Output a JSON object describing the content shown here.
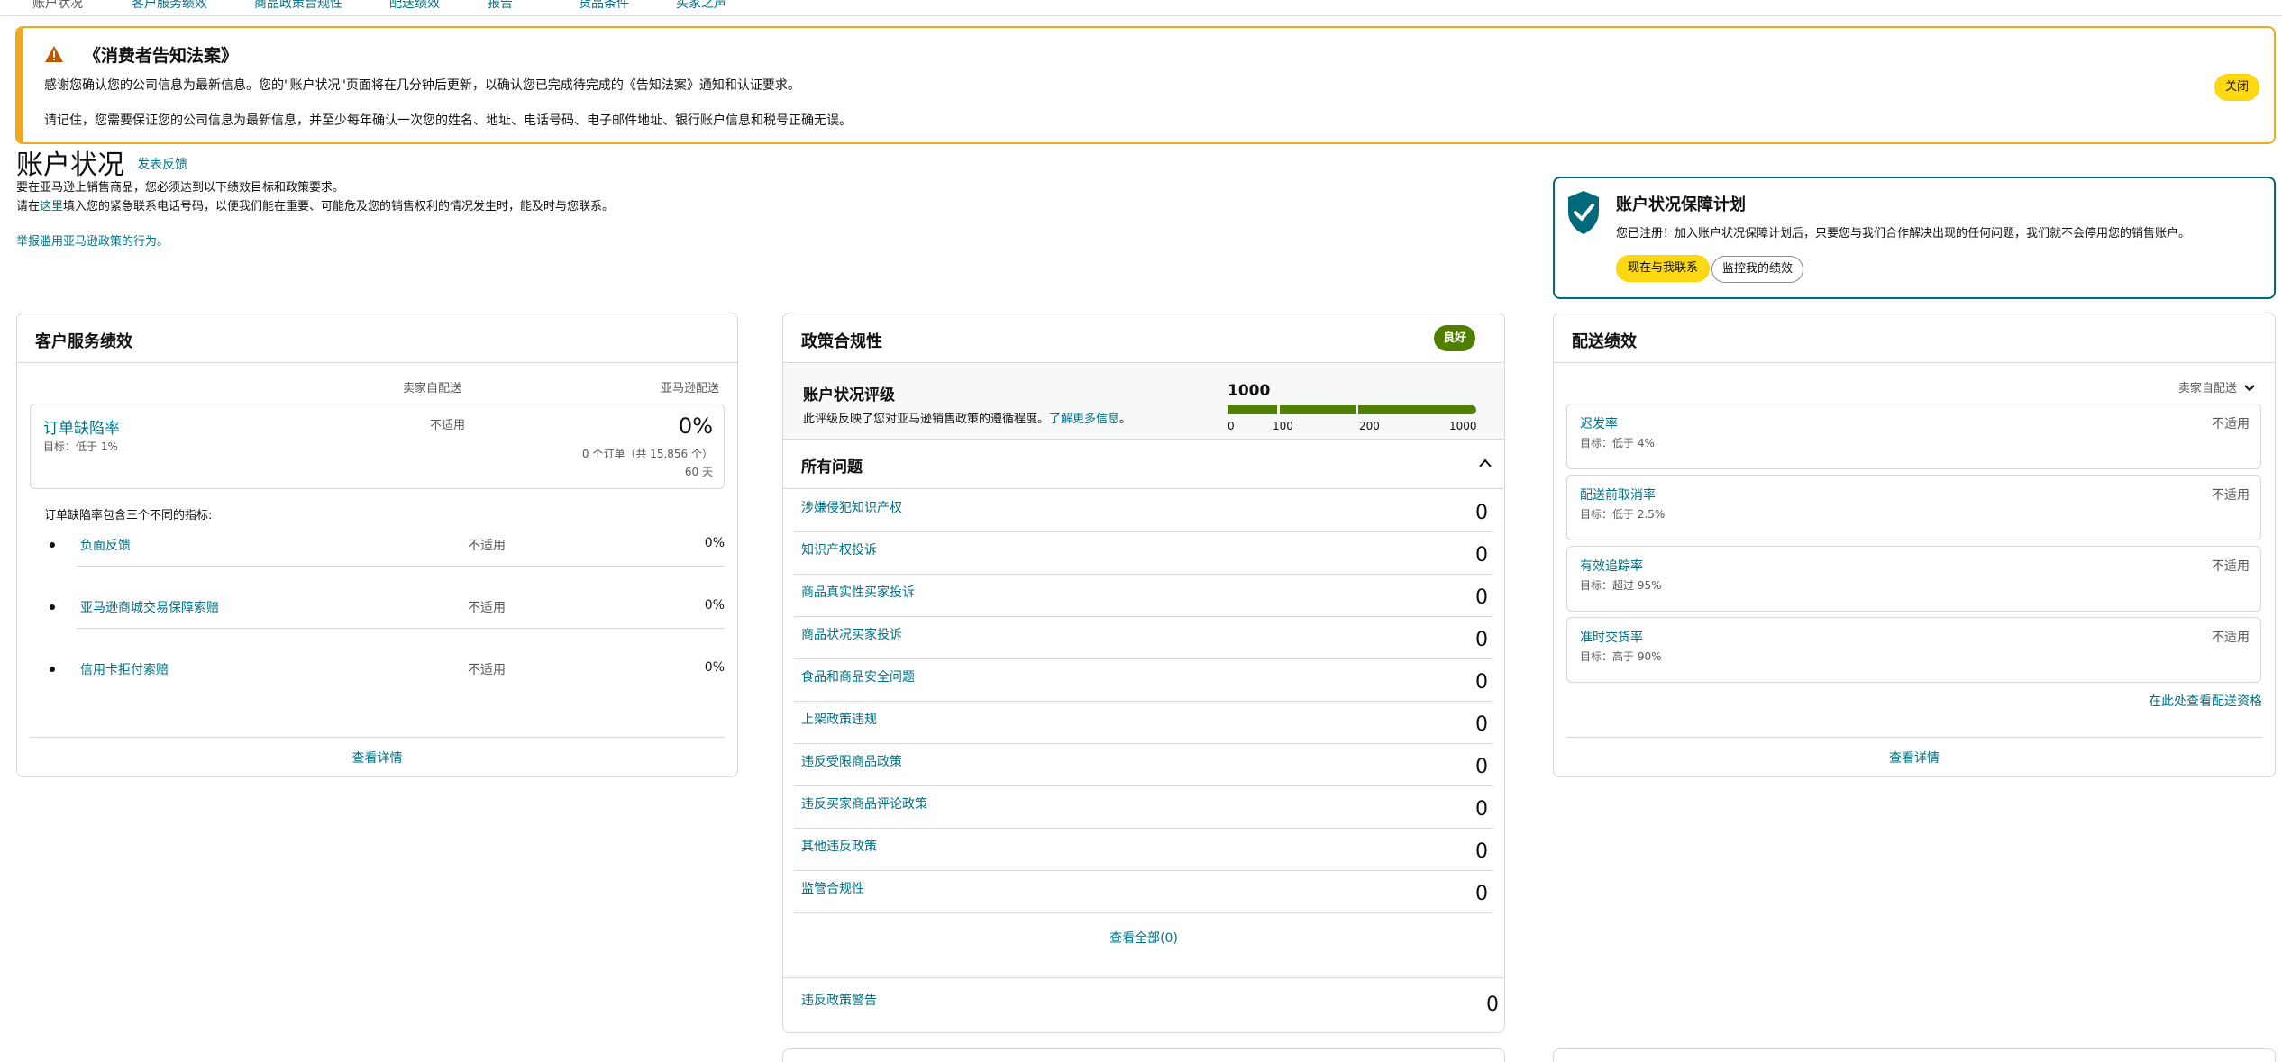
{
  "topnav": {
    "items": [
      "账户状况",
      "客户服务绩效",
      "商品政策合规性",
      "配送绩效",
      "报告",
      "货品条件",
      "买家之声"
    ]
  },
  "notice": {
    "title": "《消费者告知法案》",
    "line1": "感谢您确认您的公司信息为最新信息。您的\"账户状况\"页面将在几分钟后更新，以确认您已完成待完成的《告知法案》通知和认证要求。",
    "line2": "请记住，您需要保证您的公司信息为最新信息，并至少每年确认一次您的姓名、地址、电话号码、电子邮件地址、银行账户信息和税号正确无误。",
    "close_label": "关闭",
    "accent": "#f0a91f"
  },
  "header": {
    "title": "账户状况",
    "feedback": "发表反馈",
    "intro1": "要在亚马逊上销售商品，您必须达到以下绩效目标和政策要求。",
    "intro2_pre": "请在",
    "intro2_link": "这里",
    "intro2_post": "填入您的紧急联系电话号码，以便我们能在重要、可能危及您的销售权利的情况发生时，能及时与您联系。",
    "report": "举报滥用亚马逊政策的行为。"
  },
  "aha": {
    "title": "账户状况保障计划",
    "desc": "您已注册！加入账户状况保障计划后，只要您与我们合作解决出现的任何问题，我们就不会停用您的销售账户。",
    "btn_contact": "现在与我联系",
    "btn_monitor": "监控我的绩效",
    "accent": "#00697b"
  },
  "cs": {
    "title": "客户服务绩效",
    "col_seller": "卖家自配送",
    "col_amazon": "亚马逊配送",
    "odr": {
      "name": "订单缺陷率",
      "target": "目标：低于 1%",
      "seller_value": "不适用",
      "amazon_value": "0%",
      "orders": "0 个订单（共 15,856 个）",
      "days": "60 天"
    },
    "note": "订单缺陷率包含三个不同的指标:",
    "metrics": [
      {
        "name": "负面反馈",
        "seller": "不适用",
        "amazon": "0%"
      },
      {
        "name": "亚马逊商城交易保障索赔",
        "seller": "不适用",
        "amazon": "0%"
      },
      {
        "name": "信用卡拒付索赔",
        "seller": "不适用",
        "amazon": "0%"
      }
    ],
    "detail": "查看详情"
  },
  "policy": {
    "title": "政策合规性",
    "badge": "良好",
    "badge_color": "#507f00",
    "rating_title": "账户状况评级",
    "rating_desc": "此评级反映了您对亚马逊销售政策的遵循程度。",
    "rating_link": "了解更多信息",
    "rating_desc_end": "。",
    "rating_value": "1000",
    "rating_level": 1.0,
    "ticks": [
      "0",
      "100",
      "200",
      "1000"
    ],
    "issues_title": "所有问题",
    "issues": [
      {
        "name": "涉嫌侵犯知识产权",
        "count": "0"
      },
      {
        "name": "知识产权投诉",
        "count": "0"
      },
      {
        "name": "商品真实性买家投诉",
        "count": "0"
      },
      {
        "name": "商品状况买家投诉",
        "count": "0"
      },
      {
        "name": "食品和商品安全问题",
        "count": "0"
      },
      {
        "name": "上架政策违规",
        "count": "0"
      },
      {
        "name": "违反受限商品政策",
        "count": "0"
      },
      {
        "name": "违反买家商品评论政策",
        "count": "0"
      },
      {
        "name": "其他违反政策",
        "count": "0"
      },
      {
        "name": "监管合规性",
        "count": "0"
      }
    ],
    "view_all": "查看全部(0)",
    "warning_name": "违反政策警告",
    "warning_count": "0"
  },
  "shipping": {
    "title": "配送绩效",
    "selector": "卖家自配送",
    "metrics": [
      {
        "name": "迟发率",
        "target": "目标：低于 4%",
        "value": "不适用"
      },
      {
        "name": "配送前取消率",
        "target": "目标：低于 2.5%",
        "value": "不适用"
      },
      {
        "name": "有效追踪率",
        "target": "目标：超过 95%",
        "value": "不适用"
      },
      {
        "name": "准时交货率",
        "target": "目标：高于 90%",
        "value": "不适用"
      }
    ],
    "eligibility": "在此处查看配送资格",
    "detail": "查看详情"
  }
}
